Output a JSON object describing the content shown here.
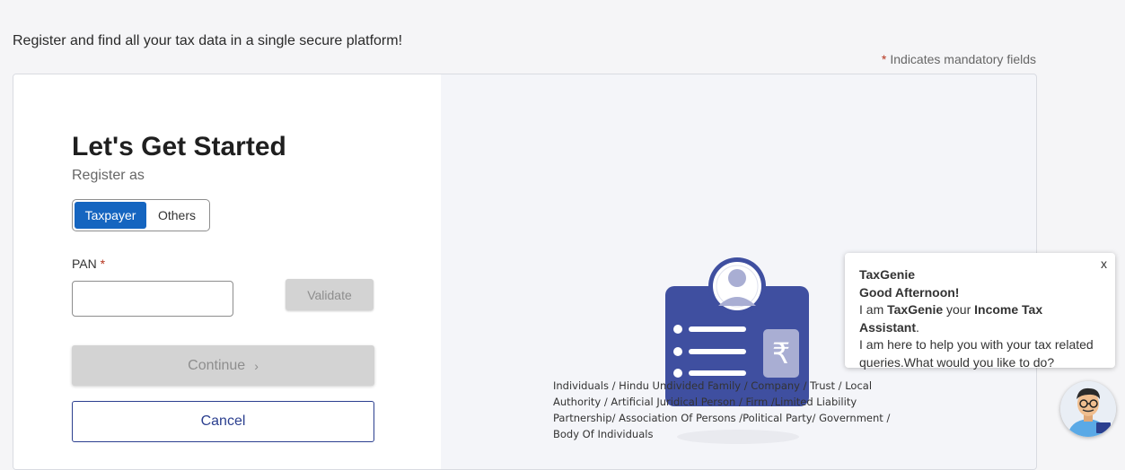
{
  "header": {
    "tagline": "Register and find all your tax data in a single secure platform!",
    "mandatory_star": "*",
    "mandatory_note": "Indicates mandatory fields"
  },
  "form": {
    "title": "Let's Get Started",
    "register_as_label": "Register as",
    "toggle": {
      "options": [
        "Taxpayer",
        "Others"
      ],
      "selected": "Taxpayer"
    },
    "pan": {
      "label": "PAN",
      "required_marker": "*",
      "value": "",
      "placeholder": ""
    },
    "validate_label": "Validate",
    "continue_label": "Continue",
    "cancel_label": "Cancel"
  },
  "illustration": {
    "icon": "id-card-rupee-icon",
    "rupee_symbol": "₹",
    "description": "Individuals / Hindu Undivided Family / Company / Trust / Local Authority / Artificial Juridical Person / Firm /Limited Liability Partnership/ Association Of Persons /Political Party/ Government / Body Of Individuals"
  },
  "taxgenie": {
    "close_label": "x",
    "name": "TaxGenie",
    "greeting": "Good Afternoon!",
    "intro_prefix": "I am ",
    "intro_name": "TaxGenie",
    "intro_middle": " your ",
    "intro_role": "Income Tax Assistant",
    "intro_suffix": ".",
    "help_text": "I am here to help you with your tax related queries.What would you like to do?",
    "avatar_icon": "assistant-avatar-icon"
  },
  "colors": {
    "primary": "#1565c0",
    "navy": "#2b3f8f",
    "card_illustration": "#3f4fa0",
    "required": "#b5341e",
    "disabled_bg": "#d3d3d3"
  }
}
